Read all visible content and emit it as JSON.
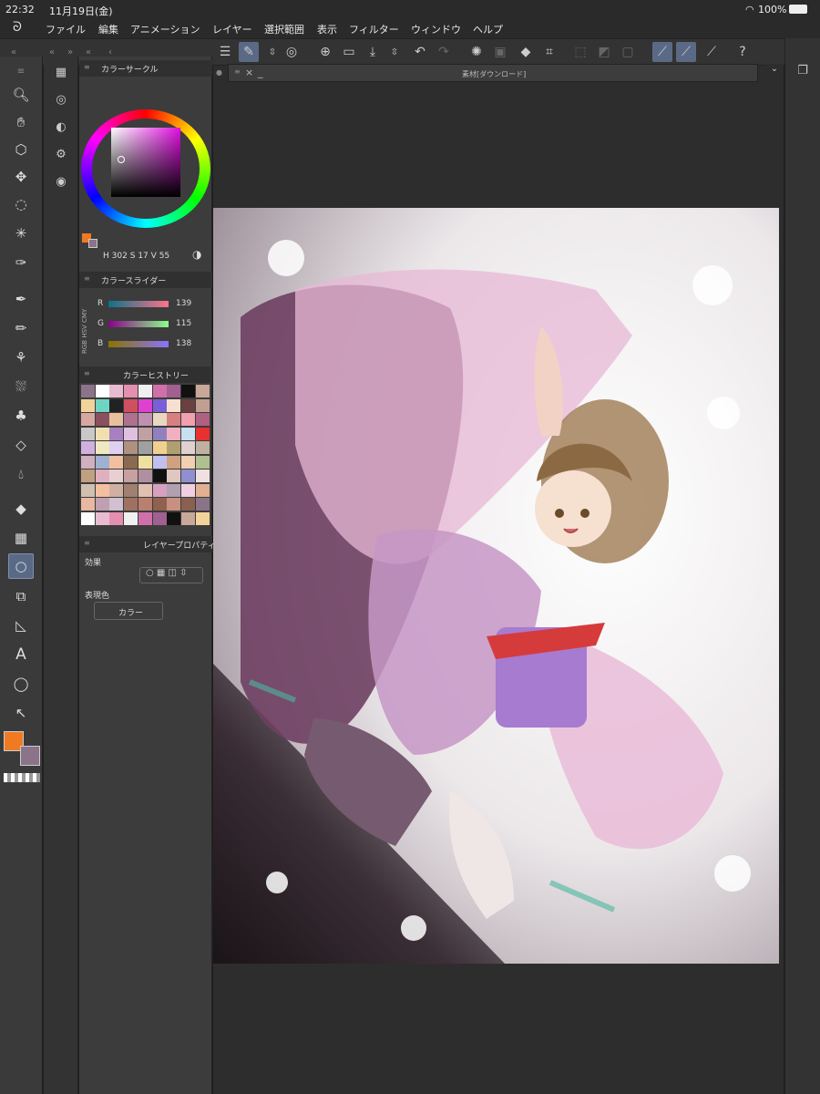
{
  "status_bar": {
    "time": "22:32",
    "date": "11月19日(金)",
    "battery": "100%"
  },
  "menu": [
    "ファイル",
    "編集",
    "アニメーション",
    "レイヤー",
    "選択範囲",
    "表示",
    "フィルター",
    "ウィンドウ",
    "ヘルプ"
  ],
  "panels": {
    "color_circle": {
      "title": "カラーサークル",
      "h_label": "H",
      "h": "302",
      "s_label": "S",
      "s": "17",
      "v_label": "V",
      "v": "55"
    },
    "color_slider": {
      "title": "カラースライダー",
      "r_label": "R",
      "r": "139",
      "g_label": "G",
      "g": "115",
      "b_label": "B",
      "b": "138",
      "modes": [
        "RGB",
        "HSV",
        "CMY"
      ]
    },
    "color_history": {
      "title": "カラーヒストリー"
    },
    "layer_property": {
      "title": "レイヤープロパティ",
      "effect_label": "効果",
      "expression_label": "表現色",
      "expression_value": "カラー"
    }
  },
  "material_bar": {
    "title": "素材[ダウンロード]"
  },
  "colors": {
    "main": "#f07a22",
    "sub": "#8b738a",
    "accent": "#5a6a86"
  }
}
